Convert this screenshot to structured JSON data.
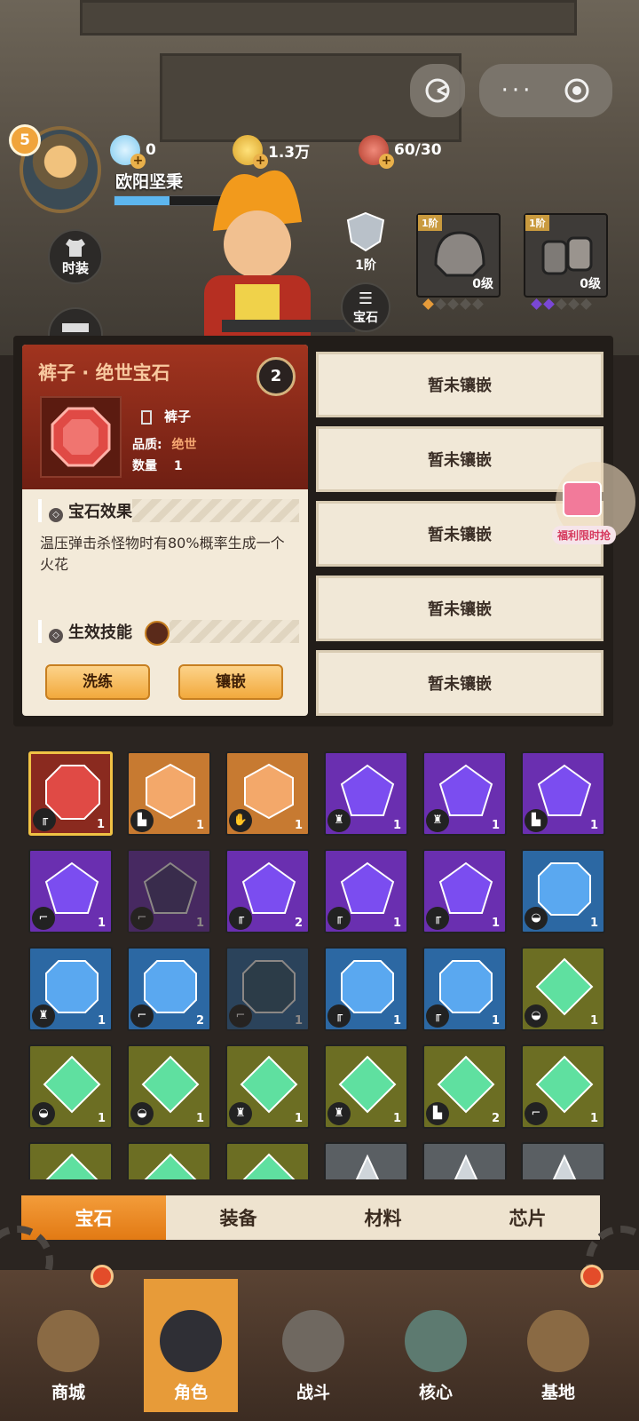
{
  "player": {
    "level": "5",
    "name": "欧阳坚秉",
    "exp_fraction": 0.35
  },
  "resources": [
    {
      "icon": "diamond-icon",
      "value": "0"
    },
    {
      "icon": "coin-icon",
      "value": "1.3万"
    },
    {
      "icon": "meat-icon",
      "value": "60/30"
    }
  ],
  "side_buttons": {
    "fashion": "时装",
    "gem": "宝石"
  },
  "rank": "1阶",
  "equipment": [
    {
      "tier": "1阶",
      "level": "0级",
      "icon": "helmet-icon"
    },
    {
      "tier": "1阶",
      "level": "0级",
      "icon": "gloves-icon"
    }
  ],
  "popup": {
    "title": "裤子 · 绝世宝石",
    "slot_label": "裤子",
    "quality_label": "品质:",
    "quality_value": "绝世",
    "quantity_label": "数量",
    "quantity_value": "1",
    "effect_section": "宝石效果",
    "effect_text": "温压弹击杀怪物时有80%概率生成一个火花",
    "skill_section": "生效技能",
    "refine_button": "洗练",
    "inlay_button": "镶嵌",
    "flag_text": "2"
  },
  "empty_slots": [
    "暂未镶嵌",
    "暂未镶嵌",
    "暂未镶嵌",
    "暂未镶嵌",
    "暂未镶嵌"
  ],
  "promo": {
    "label": "福利限时抢"
  },
  "gems": [
    {
      "color": "red",
      "slot": "pants",
      "count": "1"
    },
    {
      "color": "orange",
      "slot": "boots",
      "count": "1"
    },
    {
      "color": "orange",
      "slot": "gloves",
      "count": "1"
    },
    {
      "color": "purple",
      "slot": "armor",
      "count": "1"
    },
    {
      "color": "purple",
      "slot": "armor",
      "count": "1"
    },
    {
      "color": "purple",
      "slot": "boots",
      "count": "1"
    },
    {
      "color": "purple",
      "slot": "gun",
      "count": "1"
    },
    {
      "color": "purple-dim",
      "slot": "gun",
      "count": "1"
    },
    {
      "color": "purple",
      "slot": "pants",
      "count": "2"
    },
    {
      "color": "purple",
      "slot": "pants",
      "count": "1"
    },
    {
      "color": "purple",
      "slot": "pants",
      "count": "1"
    },
    {
      "color": "blue",
      "slot": "helmet",
      "count": "1"
    },
    {
      "color": "blue",
      "slot": "armor",
      "count": "1"
    },
    {
      "color": "blue",
      "slot": "gun",
      "count": "2"
    },
    {
      "color": "blue-dim",
      "slot": "gun",
      "count": "1"
    },
    {
      "color": "blue",
      "slot": "pants",
      "count": "1"
    },
    {
      "color": "blue",
      "slot": "pants",
      "count": "1"
    },
    {
      "color": "green",
      "slot": "helmet",
      "count": "1"
    },
    {
      "color": "green",
      "slot": "helmet",
      "count": "1"
    },
    {
      "color": "green",
      "slot": "helmet",
      "count": "1"
    },
    {
      "color": "green",
      "slot": "armor",
      "count": "1"
    },
    {
      "color": "green",
      "slot": "armor",
      "count": "1"
    },
    {
      "color": "green",
      "slot": "boots",
      "count": "2"
    },
    {
      "color": "green",
      "slot": "gun",
      "count": "1"
    },
    {
      "color": "green",
      "slot": "",
      "count": ""
    },
    {
      "color": "green",
      "slot": "",
      "count": ""
    },
    {
      "color": "green",
      "slot": "",
      "count": ""
    },
    {
      "color": "gray",
      "slot": "",
      "count": ""
    },
    {
      "color": "gray",
      "slot": "",
      "count": ""
    },
    {
      "color": "gray",
      "slot": "",
      "count": ""
    }
  ],
  "tabs": [
    "宝石",
    "装备",
    "材料",
    "芯片"
  ],
  "nav": [
    {
      "label": "商城",
      "icon": "shop-icon"
    },
    {
      "label": "角色",
      "icon": "character-icon"
    },
    {
      "label": "战斗",
      "icon": "battle-icon"
    },
    {
      "label": "核心",
      "icon": "core-icon"
    },
    {
      "label": "基地",
      "icon": "base-icon"
    }
  ]
}
